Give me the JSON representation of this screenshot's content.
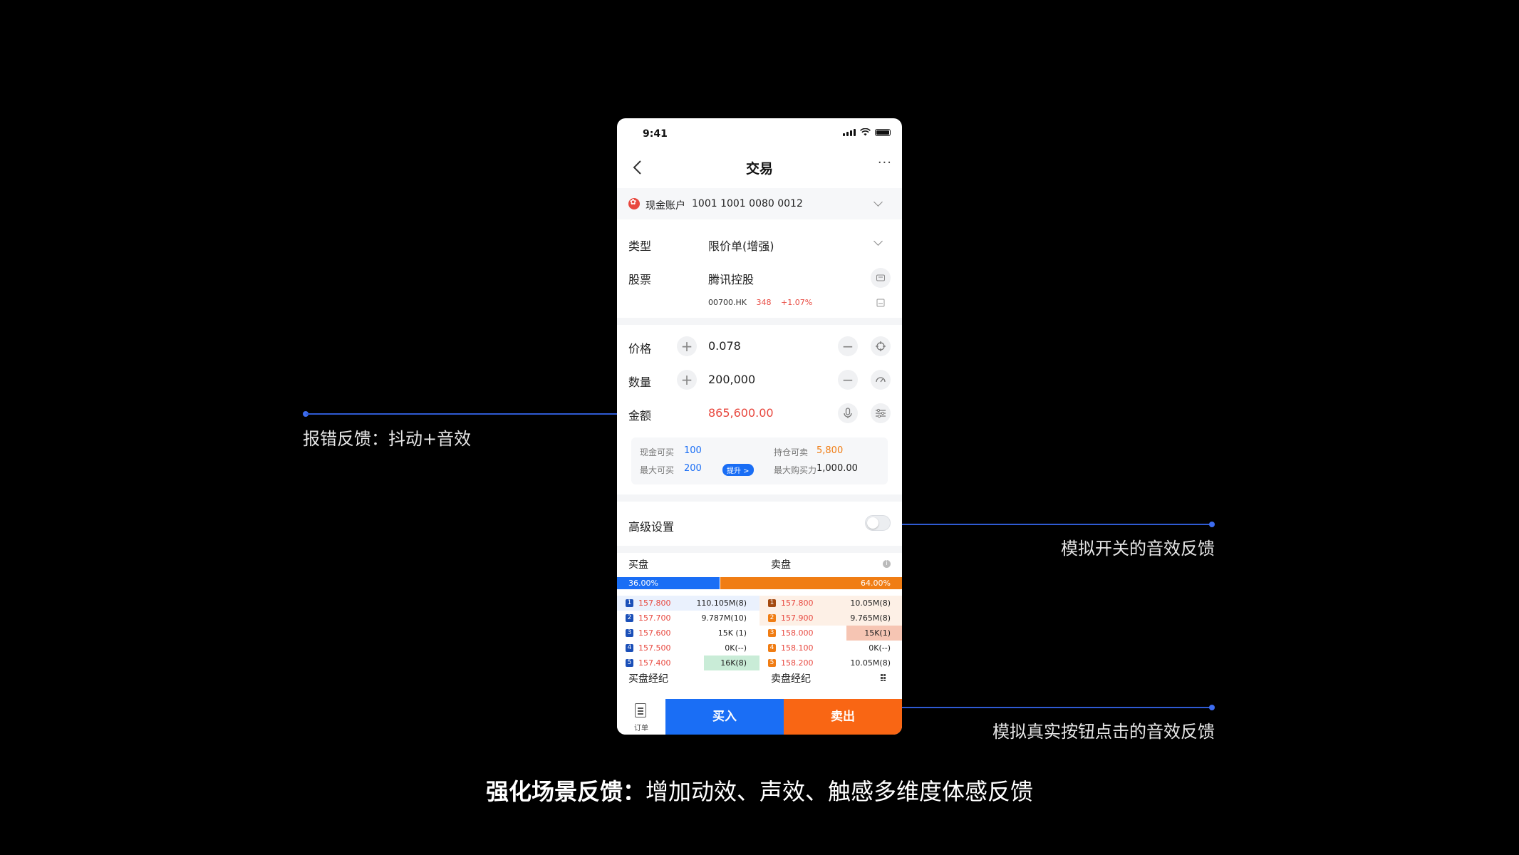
{
  "annotations": {
    "left": "报错反馈：抖动+音效",
    "right_top": "模拟开关的音效反馈",
    "right_bottom": "模拟真实按钮点击的音效反馈"
  },
  "caption": {
    "bold": "强化场景反馈：",
    "rest": "增加动效、声效、触感多维度体感反馈"
  },
  "colors": {
    "blue": "#1a6ef5",
    "orange": "#f07d14",
    "red": "#e8483f",
    "line": "#2f5bd4"
  },
  "phone": {
    "status_time": "9:41",
    "nav": {
      "title": "交易",
      "back_icon": "chevron-left-icon",
      "more": "···"
    },
    "account": {
      "label": "现金账户",
      "number": "1001 1001 0080 0012"
    },
    "form": {
      "type_label": "类型",
      "type_value": "限价单(增强)",
      "stock_label": "股票",
      "stock_value": "腾讯控股",
      "stock_code": "00700.HK",
      "stock_price": "348",
      "stock_change": "+1.07%",
      "price_label": "价格",
      "price_value": "0.078",
      "qty_label": "数量",
      "qty_value": "200,000",
      "amount_label": "金额",
      "amount_value": "865,600.00"
    },
    "info": {
      "cash_buy_label": "现金可买",
      "cash_buy_value": "100",
      "max_buy_label": "最大可买",
      "max_buy_value": "200",
      "upgrade": "提升 >",
      "hold_sell_label": "持仓可卖",
      "hold_sell_value": "5,800",
      "max_power_label": "最大购买力",
      "max_power_value": "1,000.00"
    },
    "advanced_label": "高级设置",
    "advanced_enabled": false,
    "depth": {
      "bid_title": "买盘",
      "ask_title": "卖盘",
      "bid_ratio": 0.36,
      "bid_pct": "36.00%",
      "ask_pct": "64.00%",
      "bids": [
        {
          "level": "1",
          "price": "157.800",
          "vol": "110.105M(8)"
        },
        {
          "level": "2",
          "price": "157.700",
          "vol": "9.787M(10)"
        },
        {
          "level": "3",
          "price": "157.600",
          "vol": "15K (1)"
        },
        {
          "level": "4",
          "price": "157.500",
          "vol": "0K(--)"
        },
        {
          "level": "5",
          "price": "157.400",
          "vol": "16K(8)"
        }
      ],
      "asks": [
        {
          "level": "1",
          "price": "157.800",
          "vol": "10.05M(8)"
        },
        {
          "level": "2",
          "price": "157.900",
          "vol": "9.765M(8)"
        },
        {
          "level": "3",
          "price": "158.000",
          "vol": "15K(1)"
        },
        {
          "level": "4",
          "price": "158.100",
          "vol": "0K(--)"
        },
        {
          "level": "5",
          "price": "158.200",
          "vol": "10.05M(8)"
        }
      ],
      "bid_broker": "买盘经纪",
      "ask_broker": "卖盘经纪"
    },
    "bottom": {
      "orders": "订单",
      "buy": "买入",
      "sell": "卖出"
    }
  }
}
